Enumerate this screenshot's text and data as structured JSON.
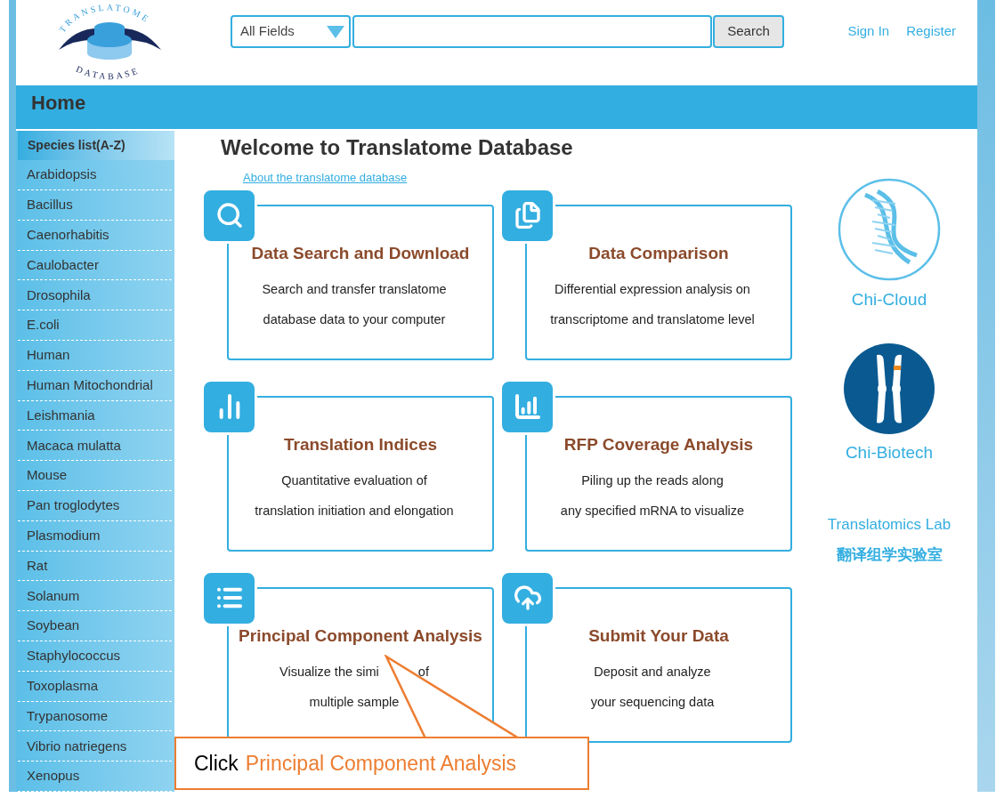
{
  "logo": {
    "top": "TRANSLATOME",
    "bottom": "DATABASE"
  },
  "search": {
    "field_select": "All Fields",
    "button": "Search"
  },
  "auth_links": [
    "Sign In",
    "Register"
  ],
  "nav_bar": {
    "title": "Home"
  },
  "sidebar": {
    "title": "Species list(A-Z)",
    "items": [
      "Arabidopsis",
      "Bacillus",
      "Caenorhabitis",
      "Caulobacter",
      "Drosophila",
      "E.coli",
      "Human",
      "Human Mitochondrial",
      "Leishmania",
      "Macaca mulatta",
      "Mouse",
      "Pan troglodytes",
      "Plasmodium",
      "Rat",
      "Solanum",
      "Soybean",
      "Staphylococcus",
      "Toxoplasma",
      "Trypanosome",
      "Vibrio natriegens",
      "Xenopus"
    ]
  },
  "main": {
    "title": "Welcome to Translatome Database",
    "about_link": "About the translatome database",
    "cards": [
      {
        "kind": "search",
        "title": "Data Search and Download",
        "lines": [
          [
            "Search and transfer translatome"
          ],
          [
            "database data to your computer"
          ]
        ]
      },
      {
        "kind": "documents",
        "title": "Data Comparison",
        "lines": [
          [
            "Differential expression analysis on"
          ],
          [
            "transcriptome and translatome level"
          ]
        ]
      },
      {
        "kind": "bars",
        "title": "Translation Indices",
        "lines": [
          [
            "Quantitative evaluation of"
          ],
          [
            "translation initiation and elongation"
          ]
        ]
      },
      {
        "kind": "rising-bars",
        "title": "RFP Coverage Analysis",
        "lines": [
          [
            "Piling up the reads along"
          ],
          [
            "any specified mRNA to visualize"
          ]
        ]
      },
      {
        "kind": "list",
        "title": "Principal Component Analysis",
        "lines": [
          [
            "Visualize the simi",
            "of"
          ],
          [
            "multiple sample"
          ]
        ]
      },
      {
        "kind": "upload",
        "title": "Submit Your Data",
        "lines": [
          [
            "Deposit and analyze"
          ],
          [
            "your sequencing data"
          ]
        ]
      }
    ]
  },
  "partners": [
    {
      "kind": "dna",
      "label": "Chi-Cloud"
    },
    {
      "kind": "chromosome",
      "label": "Chi-Biotech"
    }
  ],
  "lab": {
    "name": "Translatomics Lab",
    "name_cn": "翻译组学实验室"
  },
  "callout": {
    "prefix": "Click",
    "highlight": "Principal Component Analysis"
  }
}
